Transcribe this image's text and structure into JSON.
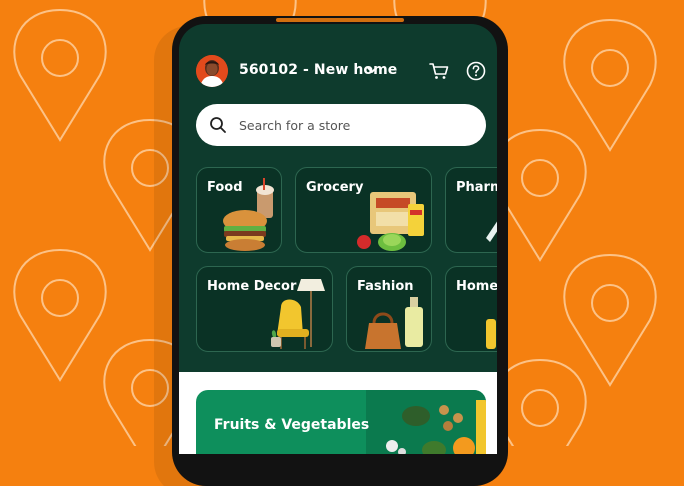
{
  "header": {
    "location": "560102 - New home"
  },
  "search": {
    "placeholder": "Search for a store"
  },
  "categories_row1": [
    {
      "label": "Food"
    },
    {
      "label": "Grocery"
    },
    {
      "label": "Pharm"
    }
  ],
  "categories_row2": [
    {
      "label": "Home Decor"
    },
    {
      "label": "Fashion"
    },
    {
      "label": "Home"
    }
  ],
  "promo": {
    "title": "Fruits & Vegetables"
  },
  "colors": {
    "background": "#F5800F",
    "screen": "#0E3B2D",
    "card": "#0A3225",
    "promo": "#0E8F5C"
  }
}
